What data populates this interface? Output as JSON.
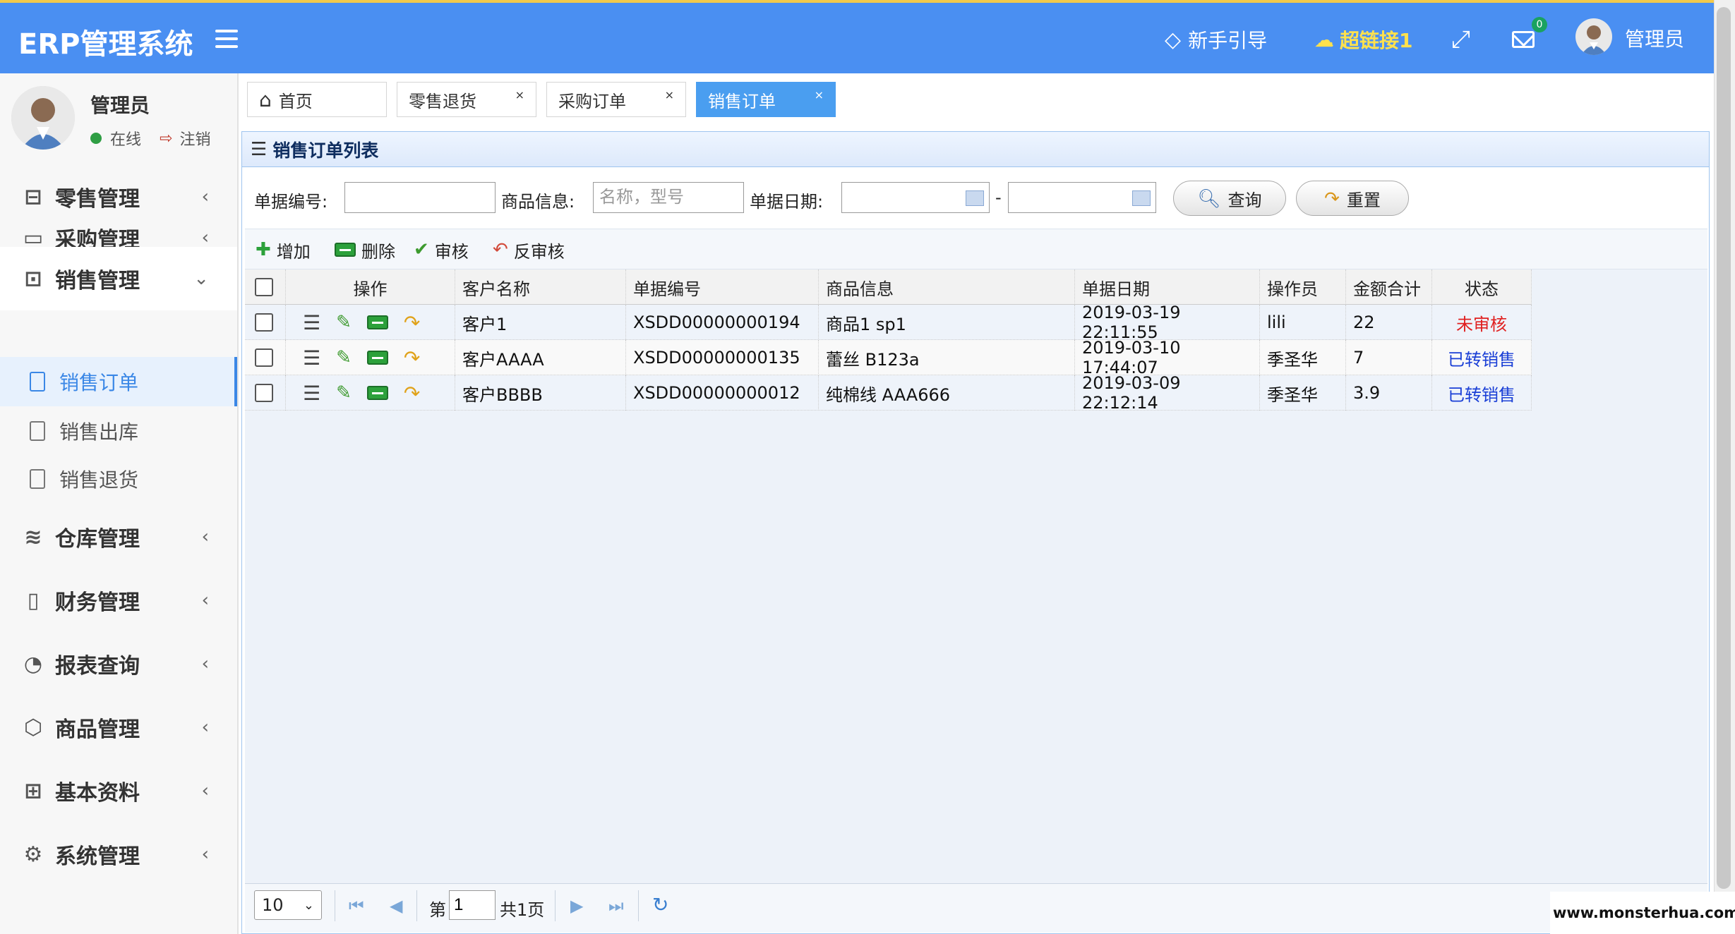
{
  "header": {
    "brand": "ERP管理系统",
    "guide_label": "新手引导",
    "link_label": "超链接1",
    "mail_count": "0",
    "user_name": "管理员"
  },
  "sidebar": {
    "user_name": "管理员",
    "status_online": "在线",
    "logout": "注销",
    "items": [
      {
        "label": "零售管理",
        "icon": "gift-icon"
      },
      {
        "label": "采购管理",
        "icon": "monitor-icon"
      },
      {
        "label": "销售管理",
        "icon": "briefcase-icon"
      },
      {
        "label": "仓库管理",
        "icon": "layers-icon"
      },
      {
        "label": "财务管理",
        "icon": "book-icon"
      },
      {
        "label": "报表查询",
        "icon": "clock-icon"
      },
      {
        "label": "商品管理",
        "icon": "dropbox-icon"
      },
      {
        "label": "基本资料",
        "icon": "grid-icon"
      },
      {
        "label": "系统管理",
        "icon": "gear-icon"
      }
    ],
    "sub_items": [
      "销售订单",
      "销售出库",
      "销售退货"
    ]
  },
  "tabs": [
    {
      "label": "首页"
    },
    {
      "label": "零售退货",
      "close": "×"
    },
    {
      "label": "采购订单",
      "close": "×"
    },
    {
      "label": "销售订单",
      "close": "×"
    }
  ],
  "panel": {
    "title": "销售订单列表"
  },
  "filter": {
    "bill_no_label": "单据编号:",
    "goods_label": "商品信息:",
    "goods_placeholder": "名称，型号",
    "date_label": "单据日期:",
    "dash": "-",
    "query_label": "查询",
    "reset_label": "重置"
  },
  "toolbar": {
    "add": "增加",
    "delete": "删除",
    "audit": "审核",
    "unaudit": "反审核"
  },
  "table": {
    "headers": [
      "操作",
      "客户名称",
      "单据编号",
      "商品信息",
      "单据日期",
      "操作员",
      "金额合计",
      "状态"
    ],
    "rows": [
      {
        "customer": "客户1",
        "bill_no": "XSDD00000000194",
        "goods": "商品1 sp1",
        "date": "2019-03-19 22:11:55",
        "operator": "lili",
        "amount": "22",
        "status": "未审核"
      },
      {
        "customer": "客户AAAA",
        "bill_no": "XSDD00000000135",
        "goods": "蕾丝 B123a",
        "date": "2019-03-10 17:44:07",
        "operator": "季圣华",
        "amount": "7",
        "status": "已转销售"
      },
      {
        "customer": "客户BBBB",
        "bill_no": "XSDD00000000012",
        "goods": "纯棉线 AAA666",
        "date": "2019-03-09 22:12:14",
        "operator": "季圣华",
        "amount": "3.9",
        "status": "已转销售"
      }
    ]
  },
  "pager": {
    "page_size": "10",
    "page_prefix": "第",
    "page_value": "1",
    "page_total": "共1页"
  },
  "watermark": "www.monsterhua.com",
  "colors": {
    "header": "#4a8ff2",
    "accent": "#3a87e6",
    "status_red": "#e02020",
    "status_blue": "#1a3fd6"
  }
}
